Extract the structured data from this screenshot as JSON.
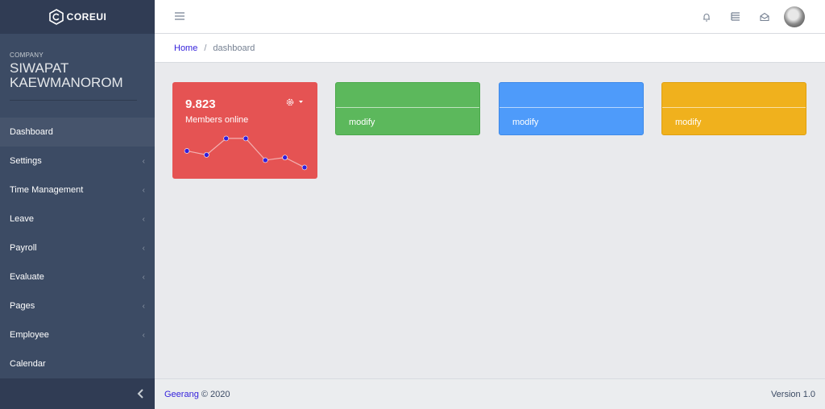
{
  "brand": {
    "name": "COREUI"
  },
  "company": {
    "caption": "COMPANY",
    "name": "SIWAPAT KAEWMANOROM"
  },
  "sidebar": {
    "items": [
      {
        "label": "Dashboard",
        "has_submenu": false,
        "active": true
      },
      {
        "label": "Settings",
        "has_submenu": true
      },
      {
        "label": "Time Management",
        "has_submenu": true
      },
      {
        "label": "Leave",
        "has_submenu": true
      },
      {
        "label": "Payroll",
        "has_submenu": true
      },
      {
        "label": "Evaluate",
        "has_submenu": true
      },
      {
        "label": "Pages",
        "has_submenu": true
      },
      {
        "label": "Employee",
        "has_submenu": true
      },
      {
        "label": "Calendar",
        "has_submenu": false
      }
    ],
    "chevron": "‹",
    "minimizer_icon": "chevron-left-icon"
  },
  "header": {
    "icons": [
      "menu-icon",
      "bell-icon",
      "list-icon",
      "envelope-icon",
      "avatar"
    ]
  },
  "breadcrumb": {
    "home": "Home",
    "separator": "/",
    "current": "dashboard"
  },
  "cards": {
    "red": {
      "value": "9.823",
      "label": "Members online",
      "color": "#e55353"
    },
    "green": {
      "action": "modify",
      "color": "#5cb85c"
    },
    "blue": {
      "action": "modify",
      "color": "#4e9bfa"
    },
    "yellow": {
      "action": "modify",
      "color": "#f0b11d"
    }
  },
  "chart_data": {
    "type": "line",
    "title": "",
    "xlabel": "",
    "ylabel": "",
    "values": [
      65,
      59,
      84,
      84,
      51,
      55,
      40
    ],
    "ylim": [
      35,
      90
    ],
    "point_color": "#321fdb",
    "line_color": "rgba(255,255,255,0.55)"
  },
  "footer": {
    "brand": "Geerang",
    "copyright": "© 2020",
    "version": "Version  1.0"
  }
}
